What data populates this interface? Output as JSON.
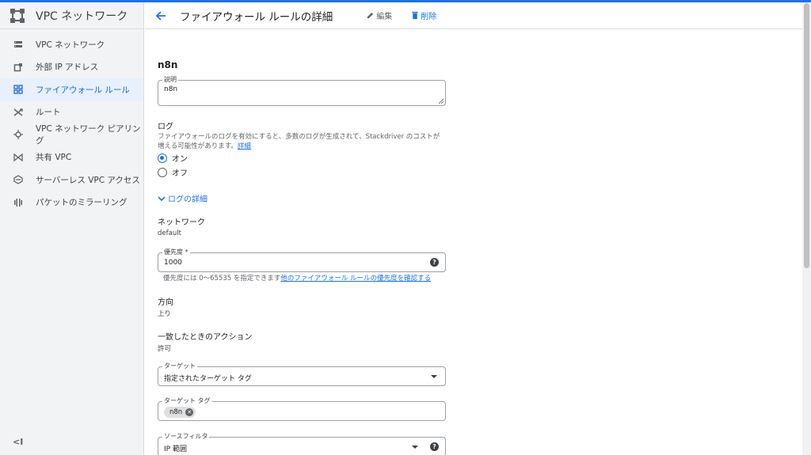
{
  "product": {
    "title": "VPC ネットワーク"
  },
  "sidebar": {
    "items": [
      {
        "label": "VPC ネットワーク",
        "icon": "vpc-network-icon"
      },
      {
        "label": "外部 IP アドレス",
        "icon": "external-ip-icon"
      },
      {
        "label": "ファイアウォール ルール",
        "icon": "firewall-icon",
        "active": true
      },
      {
        "label": "ルート",
        "icon": "route-icon"
      },
      {
        "label": "VPC ネットワーク ピアリング",
        "icon": "peering-icon"
      },
      {
        "label": "共有 VPC",
        "icon": "shared-vpc-icon"
      },
      {
        "label": "サーバーレス VPC アクセス",
        "icon": "serverless-icon"
      },
      {
        "label": "パケットのミラーリング",
        "icon": "mirroring-icon"
      }
    ],
    "collapse_label": "<I"
  },
  "header": {
    "title": "ファイアウォール ルールの詳細",
    "edit_label": "編集",
    "delete_label": "削除"
  },
  "form": {
    "rule_name": "n8n",
    "description": {
      "label": "説明",
      "value": "n8n"
    },
    "logs": {
      "label": "ログ",
      "help_text": "ファイアウォールのログを有効にすると、多数のログが生成されて、Stackdriver のコストが増える可能性があります。",
      "help_link": "詳細",
      "options": [
        {
          "label": "オン",
          "checked": true
        },
        {
          "label": "オフ",
          "checked": false
        }
      ],
      "details_toggle": "ログの詳細"
    },
    "network": {
      "label": "ネットワーク",
      "value": "default"
    },
    "priority": {
      "label": "優先度 *",
      "value": "1000",
      "hint": "優先度には 0～65535 を指定できます",
      "hint_link": "他のファイアウォール ルールの優先度を確認する"
    },
    "direction": {
      "label": "方向",
      "value": "上り"
    },
    "action": {
      "label": "一致したときのアクション",
      "value": "許可"
    },
    "target": {
      "label": "ターゲット",
      "value": "指定されたターゲット タグ"
    },
    "target_tags": {
      "label": "ターゲット タグ",
      "chips": [
        "n8n"
      ]
    },
    "source_filter": {
      "label": "ソースフィルタ",
      "value": "IP 範囲"
    }
  },
  "colors": {
    "accent": "#1a73e8",
    "active_bg": "#e8f0fe",
    "sidebar_bg": "#f1f3f4"
  }
}
